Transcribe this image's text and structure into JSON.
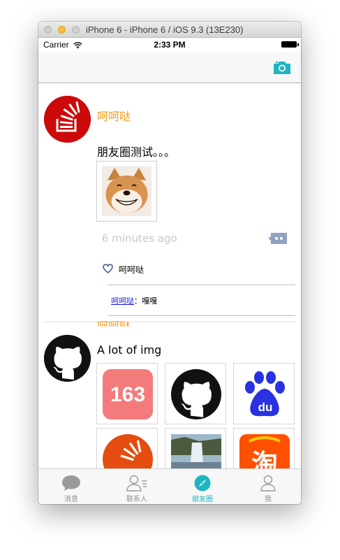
{
  "window": {
    "title": "iPhone 6 - iPhone 6 / iOS 9.3 (13E230)"
  },
  "status_bar": {
    "carrier": "Carrier",
    "time": "2:33 PM"
  },
  "colors": {
    "accent": "#1eb5c0",
    "nickname": "#f39a1f",
    "link": "#1a1ae6"
  },
  "posts": [
    {
      "nickname": "呵呵哒",
      "text": "朋友圈测试。。。",
      "time": "6 minutes ago",
      "likes": [
        "呵呵哒"
      ],
      "comments": [
        {
          "author": "呵呵哒",
          "separator": "：",
          "text": "嘎嘎"
        }
      ]
    },
    {
      "nickname": "呵呵哒",
      "text": "A lot of img",
      "images": [
        "163",
        "github-logo",
        "du",
        "stackoverflow-logo",
        "waterfall-photo",
        "淘"
      ]
    }
  ],
  "tabs": [
    {
      "label": "消息",
      "icon": "chat-bubble-icon"
    },
    {
      "label": "联系人",
      "icon": "contacts-icon"
    },
    {
      "label": "朋友圈",
      "icon": "compass-icon",
      "active": true
    },
    {
      "label": "我",
      "icon": "person-icon"
    }
  ]
}
